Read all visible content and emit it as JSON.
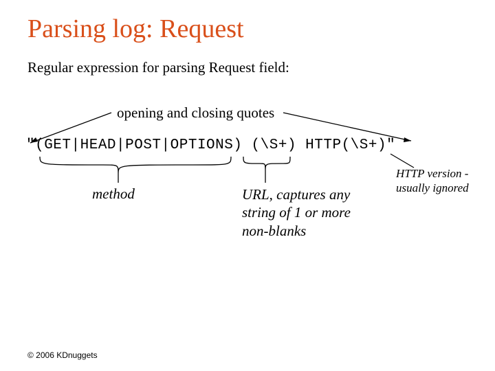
{
  "title": "Parsing log: Request",
  "subtitle": "Regular expression for parsing Request field:",
  "labels": {
    "quotes": "opening and closing quotes",
    "method": "method",
    "url": "URL, captures any string of 1 or more non-blanks",
    "http": "HTTP version - usually ignored"
  },
  "regex": "\"(GET|HEAD|POST|OPTIONS) (\\S+) HTTP(\\S+)\"",
  "footer": "© 2006 KDnuggets"
}
